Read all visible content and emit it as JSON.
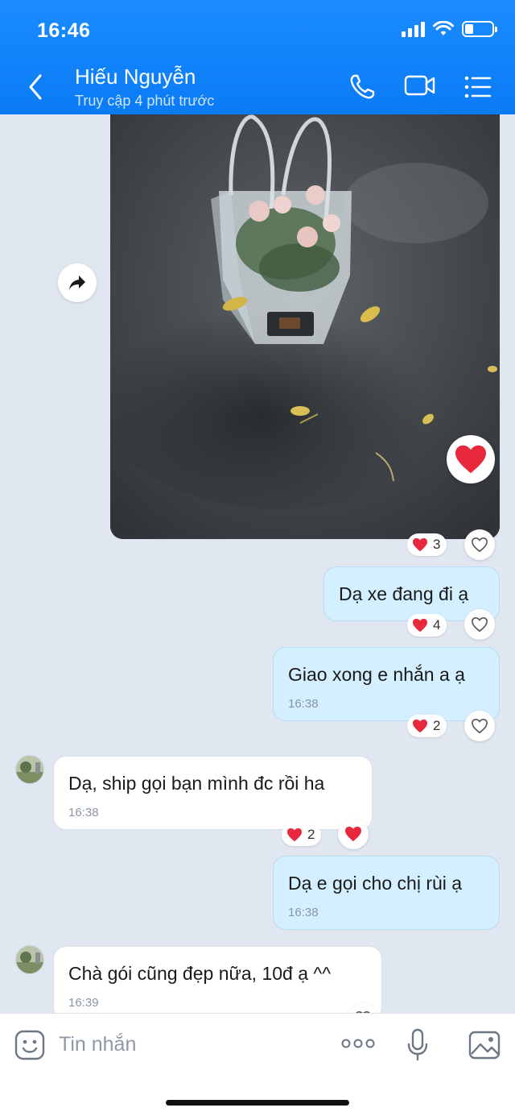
{
  "status_bar": {
    "time": "16:46"
  },
  "header": {
    "contact_name": "Hiếu Nguyễn",
    "status": "Truy cập 4 phút trước",
    "icons": [
      "back-icon",
      "phone-icon",
      "video-call-icon",
      "menu-icon"
    ]
  },
  "messages": [
    {
      "type": "image",
      "from": "them_or_me",
      "reaction_count": "3",
      "big_reaction": "heart"
    },
    {
      "type": "text",
      "from": "me",
      "text": "Dạ xe đang đi ạ",
      "reaction_count": "4"
    },
    {
      "type": "text",
      "from": "me",
      "text": "Giao xong e nhắn a ạ",
      "time": "16:38",
      "reaction_count": "2"
    },
    {
      "type": "text",
      "from": "them",
      "text": "Dạ, ship gọi bạn mình đc rồi ha",
      "time": "16:38",
      "reaction_count": "2"
    },
    {
      "type": "text",
      "from": "me",
      "text": "Dạ e gọi cho chị rùi ạ",
      "time": "16:38"
    },
    {
      "type": "text",
      "from": "them",
      "text": "Chà gói cũng đẹp nữa, 10đ ạ ^^",
      "time": "16:39"
    }
  ],
  "composer": {
    "placeholder": "Tin nhắn",
    "icons": [
      "emoji-icon",
      "more-icon",
      "microphone-icon",
      "image-icon"
    ]
  },
  "colors": {
    "header_bg": "#0a7bf5",
    "my_bubble": "#d4efff",
    "their_bubble": "#ffffff",
    "chat_bg": "#e1e7f0",
    "heart": "#e8283c"
  }
}
